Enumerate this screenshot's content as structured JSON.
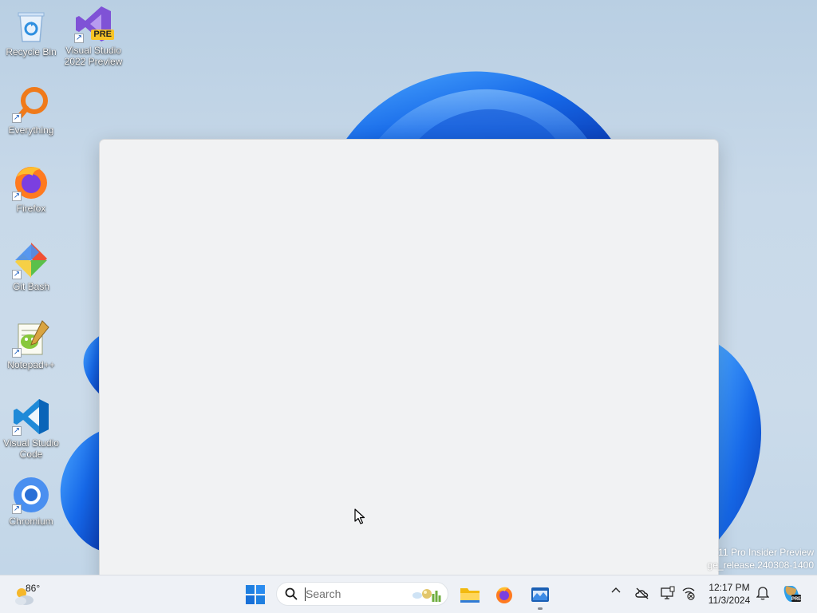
{
  "desktop": {
    "icons": [
      {
        "label": "Recycle Bin",
        "icon": "recycle-bin-icon"
      },
      {
        "label": "Visual Studio 2022 Preview",
        "icon": "visual-studio-preview-icon",
        "badge": "PRE"
      },
      {
        "label": "Everything",
        "icon": "everything-search-icon"
      },
      {
        "label": "Firefox",
        "icon": "firefox-icon"
      },
      {
        "label": "Git Bash",
        "icon": "git-bash-icon"
      },
      {
        "label": "Notepad++",
        "icon": "notepad-plus-plus-icon"
      },
      {
        "label": "Visual Studio Code",
        "icon": "vscode-icon"
      },
      {
        "label": "Chromium",
        "icon": "chromium-icon"
      }
    ],
    "watermark": {
      "line1": "11 Pro Insider Preview",
      "line2": "ge_release.240308-1400"
    }
  },
  "taskbar": {
    "weather": {
      "temperature": "86°",
      "icon": "partly-cloudy-icon"
    },
    "search": {
      "placeholder": "Search"
    },
    "pinned": [
      {
        "name": "start",
        "icon": "windows-start-icon"
      },
      {
        "name": "file-explorer",
        "icon": "file-explorer-icon"
      },
      {
        "name": "firefox",
        "icon": "firefox-icon"
      },
      {
        "name": "active-app",
        "icon": "app-window-icon",
        "running": true
      }
    ],
    "tray": {
      "icons": [
        "chevron-up-icon",
        "onedrive-offline-icon",
        "display-icon",
        "network-status-icon",
        "notification-bell-icon",
        "copilot-preview-icon"
      ],
      "time": "12:17 PM",
      "date": "11/3/2024"
    }
  },
  "colors": {
    "accent": "#0067c0",
    "taskbar": "#eef1f6",
    "window": "#f1f2f3",
    "bloom": "#1f6fe6"
  }
}
